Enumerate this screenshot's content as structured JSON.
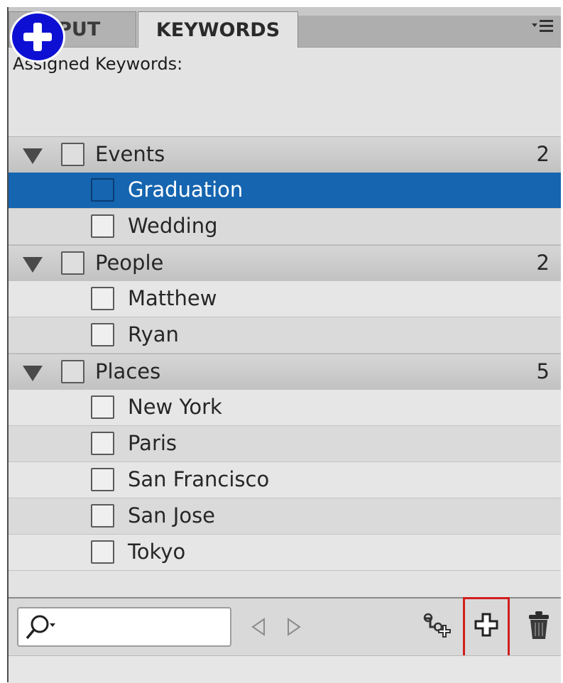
{
  "tabs": {
    "output": "TPUT",
    "keywords": "KEYWORDS"
  },
  "assigned_label": "Assigned Keywords:",
  "keyword_groups": [
    {
      "name": "Events",
      "count": "2",
      "items": [
        "Graduation",
        "Wedding"
      ]
    },
    {
      "name": "People",
      "count": "2",
      "items": [
        "Matthew",
        "Ryan"
      ]
    },
    {
      "name": "Places",
      "count": "5",
      "items": [
        "New York",
        "Paris",
        "San Francisco",
        "San Jose",
        "Tokyo"
      ]
    }
  ],
  "selected_keyword": "Graduation",
  "search": {
    "value": "",
    "placeholder": ""
  },
  "icons": {
    "panel_menu": "panel-menu-icon",
    "add_badge": "plus-circle-icon",
    "search": "magnifier-dropdown-icon",
    "prev": "triangle-left-icon",
    "next": "triangle-right-icon",
    "new_sub_keyword": "new-sub-keyword-icon",
    "new_keyword": "plus-icon",
    "delete": "trash-icon"
  },
  "colors": {
    "selection": "#1565b0",
    "highlight_box": "#d21e1e",
    "badge": "#0d10d3"
  }
}
